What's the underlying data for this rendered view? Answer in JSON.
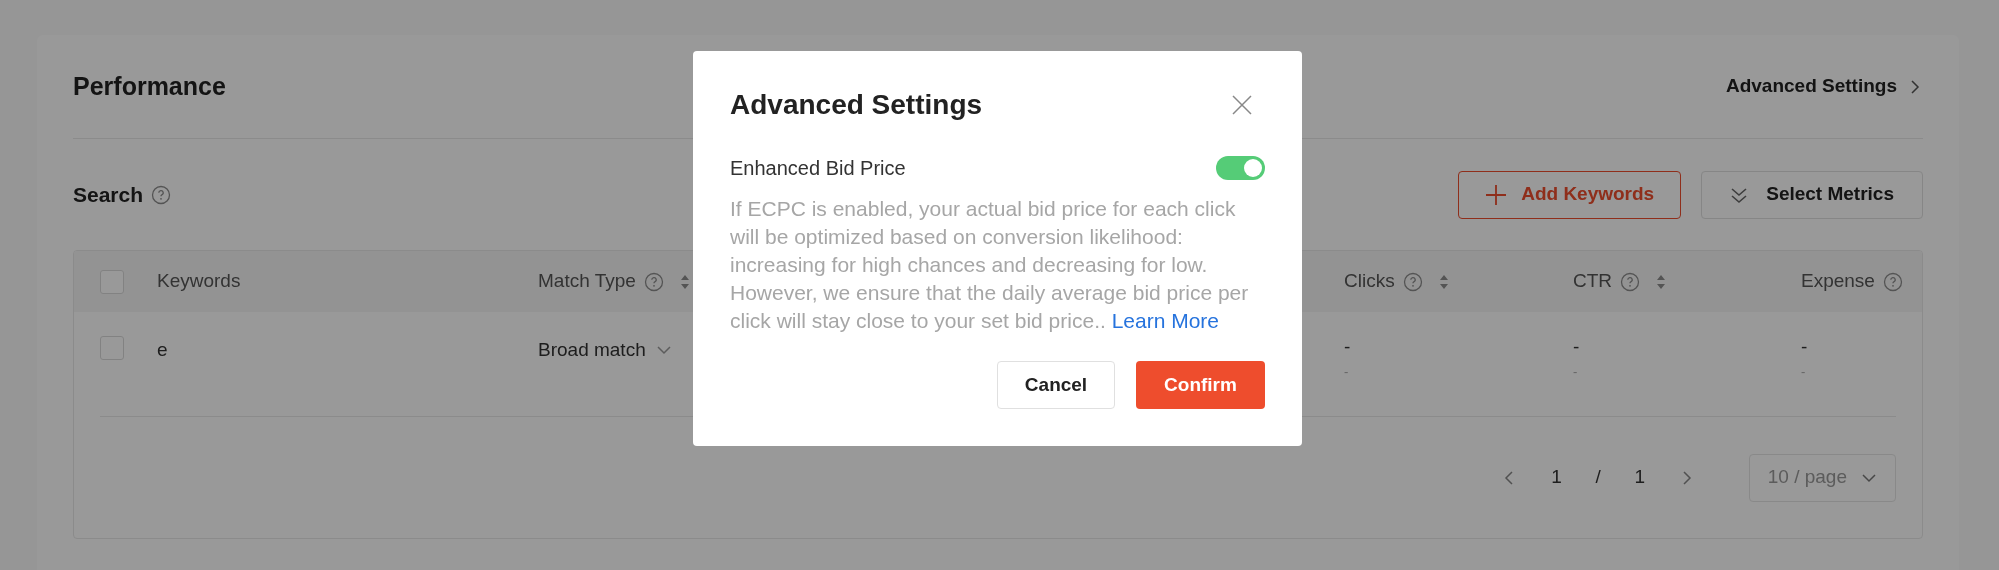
{
  "page": {
    "title": "Performance",
    "link": "Advanced Settings"
  },
  "search": {
    "title": "Search",
    "add_button": "Add Keywords",
    "metrics_button": "Select Metrics"
  },
  "table": {
    "select_all": {
      "checked": false
    },
    "columns": [
      {
        "label": "Keywords",
        "help": false,
        "sortable": false
      },
      {
        "label": "Match Type",
        "help": true,
        "sortable": true
      },
      {
        "label": "Clicks",
        "help": true,
        "sortable": true
      },
      {
        "label": "CTR",
        "help": true,
        "sortable": true
      },
      {
        "label": "Expense",
        "help": true,
        "sortable": false
      }
    ],
    "rows": [
      {
        "checked": false,
        "cells": [
          {
            "kind": "text",
            "value": "e"
          },
          {
            "kind": "dropdown",
            "value": "Broad match"
          },
          {
            "kind": "metric",
            "value": "-",
            "sub": "-"
          },
          {
            "kind": "metric",
            "value": "-",
            "sub": "-"
          },
          {
            "kind": "metric",
            "value": "-",
            "sub": "-"
          }
        ]
      }
    ]
  },
  "pagination": {
    "current": "1",
    "separator": "/",
    "total": "1",
    "page_size": "10 / page"
  },
  "dialog": {
    "title": "Advanced Settings",
    "setting": {
      "label": "Enhanced Bid Price",
      "on": true
    },
    "description": "If ECPC is enabled, your actual bid price for each click will be optimized based on conversion likelihood: increasing for high chances and decreasing for low. However, we ensure that the daily average bid price per click will stay close to your set bid price..",
    "link": "Learn More",
    "buttons": [
      {
        "label": "Cancel",
        "kind": "secondary"
      },
      {
        "label": "Confirm",
        "kind": "primary"
      }
    ]
  }
}
